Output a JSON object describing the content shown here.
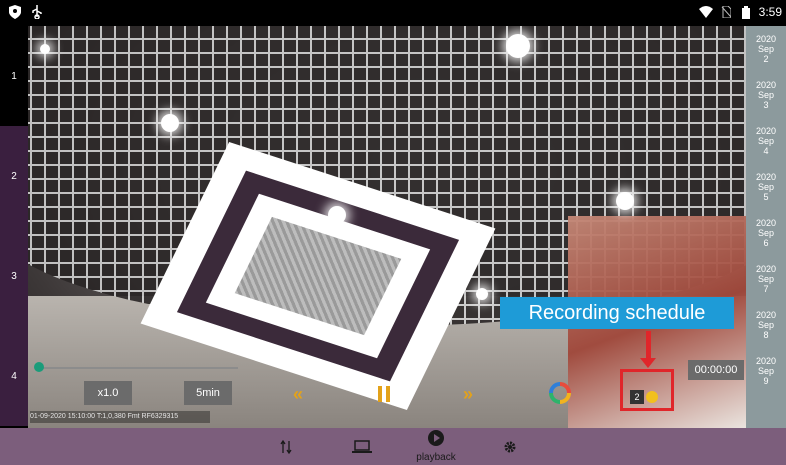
{
  "status_bar": {
    "time": "3:59",
    "icons": [
      "shield-icon",
      "usb-icon",
      "wifi-icon",
      "no-sim-icon",
      "battery-icon"
    ]
  },
  "channels": [
    {
      "label": "1",
      "active": true
    },
    {
      "label": "2",
      "active": false
    },
    {
      "label": "3",
      "active": false
    },
    {
      "label": "4",
      "active": false
    }
  ],
  "player": {
    "speed": "x1.0",
    "duration": "5min",
    "time": "00:00:00",
    "info": "01-09-2020 15:10:00 T:1,0,380 Fmt RF6329315",
    "schedule_count": "2",
    "icons": [
      "rewind-icon",
      "pause-icon",
      "fast-forward-icon",
      "refresh-icon"
    ]
  },
  "callout": {
    "text": "Recording schedule",
    "color": "#1e9bd7",
    "highlight_color": "#e0262a"
  },
  "dates": [
    {
      "year": "2020",
      "month": "Sep",
      "day": "2"
    },
    {
      "year": "2020",
      "month": "Sep",
      "day": "3"
    },
    {
      "year": "2020",
      "month": "Sep",
      "day": "4"
    },
    {
      "year": "2020",
      "month": "Sep",
      "day": "5"
    },
    {
      "year": "2020",
      "month": "Sep",
      "day": "6"
    },
    {
      "year": "2020",
      "month": "Sep",
      "day": "7"
    },
    {
      "year": "2020",
      "month": "Sep",
      "day": "8"
    },
    {
      "year": "2020",
      "month": "Sep",
      "day": "9"
    }
  ],
  "nav": {
    "playback_label": "playback",
    "icons": [
      "transfer-icon",
      "device-icon",
      "playback-icon",
      "settings-icon"
    ],
    "bar_color": "#7c5e7c"
  }
}
